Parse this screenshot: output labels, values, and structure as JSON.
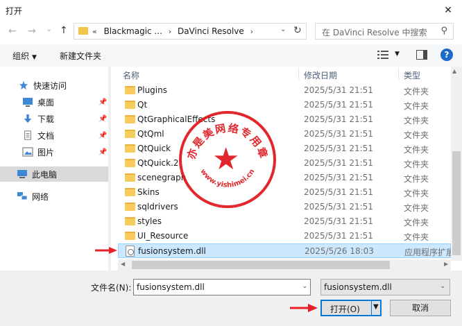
{
  "window": {
    "title": "打开"
  },
  "nav": {
    "back": "←",
    "forward": "→",
    "recent": "⌄",
    "up": "↑",
    "path": [
      "Blackmagic ...",
      "DaVinci Resolve"
    ],
    "path_prefix": "«",
    "search_placeholder": "在 DaVinci Resolve 中搜索"
  },
  "toolbar": {
    "organize": "组织",
    "new_folder": "新建文件夹"
  },
  "sidebar": {
    "items": [
      {
        "label": "快速访问",
        "icon": "star-icon"
      },
      {
        "label": "桌面",
        "icon": "desktop-icon",
        "pinned": true
      },
      {
        "label": "下载",
        "icon": "download-icon",
        "pinned": true
      },
      {
        "label": "文档",
        "icon": "document-icon",
        "pinned": true
      },
      {
        "label": "图片",
        "icon": "picture-icon",
        "pinned": true
      },
      {
        "label": "此电脑",
        "icon": "computer-icon",
        "selected": true
      },
      {
        "label": "网络",
        "icon": "network-icon"
      }
    ]
  },
  "columns": {
    "name": "名称",
    "date": "修改日期",
    "type": "类型"
  },
  "files": [
    {
      "name": "Plugins",
      "date": "2025/5/31 21:51",
      "type": "文件夹",
      "kind": "folder"
    },
    {
      "name": "Qt",
      "date": "2025/5/31 21:51",
      "type": "文件夹",
      "kind": "folder"
    },
    {
      "name": "QtGraphicalEffects",
      "date": "2025/5/31 21:51",
      "type": "文件夹",
      "kind": "folder"
    },
    {
      "name": "QtQml",
      "date": "2025/5/31 21:51",
      "type": "文件夹",
      "kind": "folder"
    },
    {
      "name": "QtQuick",
      "date": "2025/5/31 21:51",
      "type": "文件夹",
      "kind": "folder"
    },
    {
      "name": "QtQuick.2",
      "date": "2025/5/31 21:51",
      "type": "文件夹",
      "kind": "folder"
    },
    {
      "name": "scenegraph",
      "date": "2025/5/31 21:51",
      "type": "文件夹",
      "kind": "folder"
    },
    {
      "name": "Skins",
      "date": "2025/5/31 21:51",
      "type": "文件夹",
      "kind": "folder"
    },
    {
      "name": "sqldrivers",
      "date": "2025/5/31 21:51",
      "type": "文件夹",
      "kind": "folder"
    },
    {
      "name": "styles",
      "date": "2025/5/31 21:51",
      "type": "文件夹",
      "kind": "folder"
    },
    {
      "name": "UI_Resource",
      "date": "2025/5/31 21:51",
      "type": "文件夹",
      "kind": "folder"
    },
    {
      "name": "fusionsystem.dll",
      "date": "2025/5/26 18:03",
      "type": "应用程序扩展",
      "kind": "file",
      "selected": true
    }
  ],
  "bottom": {
    "filename_label": "文件名(N):",
    "filename_value": "fusionsystem.dll",
    "filetype_value": "fusionsystem.dll",
    "open_label": "打开(O)",
    "cancel_label": "取消"
  },
  "watermark": {
    "text": "亦是美网络专用章",
    "url": "www.yishimei.cn"
  },
  "colors": {
    "accent": "#0078d7",
    "stamp": "#e0151b",
    "selection": "#cce8ff"
  }
}
